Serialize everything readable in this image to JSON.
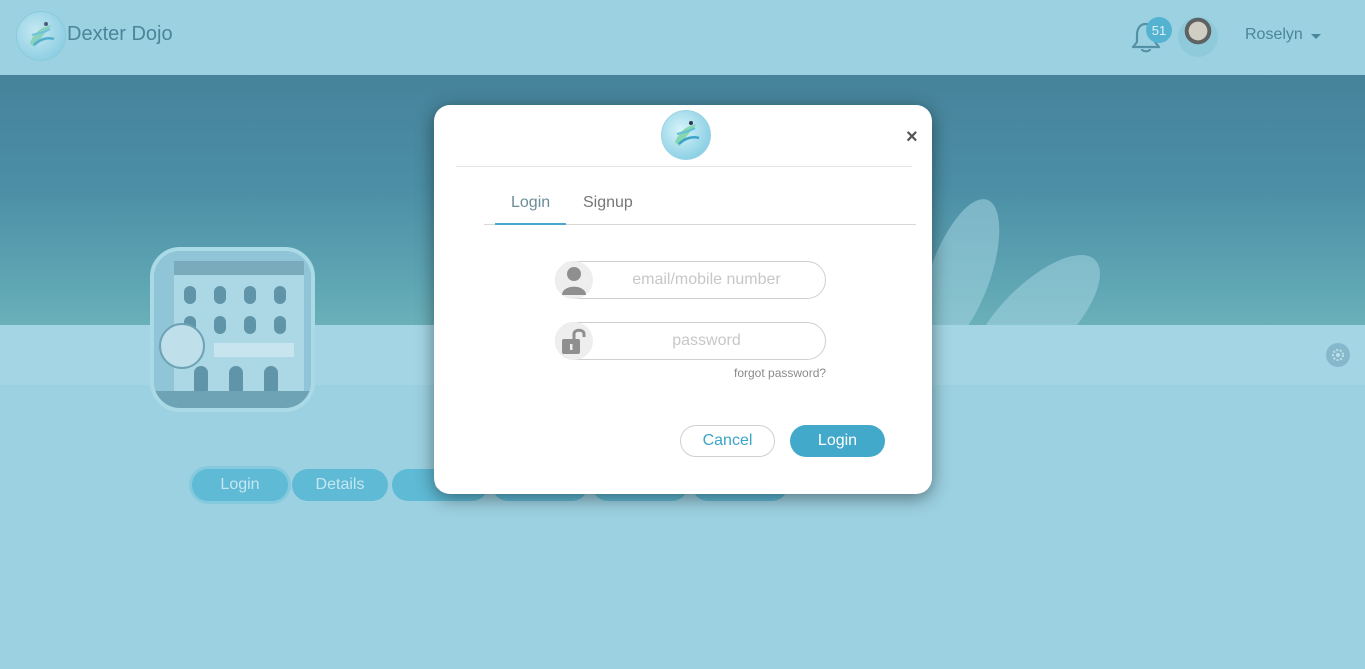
{
  "navbar": {
    "brand_name": "Dexter Dojo",
    "notification_count": "51",
    "user_name": "Roselyn"
  },
  "page_tabs": [
    {
      "label": "Login"
    },
    {
      "label": "Details"
    },
    {
      "label": "C"
    },
    {
      "label": ""
    },
    {
      "label": ""
    },
    {
      "label": ""
    }
  ],
  "modal": {
    "close_label": "×",
    "tabs": [
      {
        "label": "Login"
      },
      {
        "label": "Signup"
      }
    ],
    "email_placeholder": "email/mobile number",
    "password_placeholder": "password",
    "forgot_label": "forgot password?",
    "cancel_label": "Cancel",
    "login_label": "Login"
  },
  "colors": {
    "accent": "#42a9cb",
    "background": "#9ed3e2",
    "banner": "#2f7790"
  },
  "icons": {
    "bell": "bell-icon",
    "user": "user-icon",
    "lock": "unlock-icon",
    "settings": "gear-icon"
  }
}
